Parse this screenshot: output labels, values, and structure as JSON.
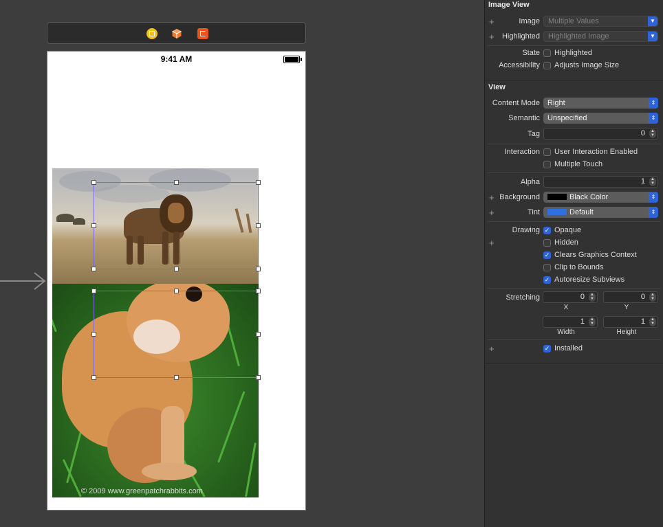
{
  "canvas": {
    "status_time": "9:41 AM",
    "watermark": "© 2009 www.greenpatchrabbits.com"
  },
  "inspector": {
    "image_view": {
      "title": "Image View",
      "image_label": "Image",
      "image_placeholder": "Multiple Values",
      "highlighted_label": "Highlighted",
      "highlighted_placeholder": "Highlighted Image",
      "state_label": "State",
      "state_checkbox": "Highlighted",
      "accessibility_label": "Accessibility",
      "accessibility_checkbox": "Adjusts Image Size"
    },
    "view": {
      "title": "View",
      "content_mode_label": "Content Mode",
      "content_mode_value": "Right",
      "semantic_label": "Semantic",
      "semantic_value": "Unspecified",
      "tag_label": "Tag",
      "tag_value": "0",
      "interaction_label": "Interaction",
      "user_interaction": "User Interaction Enabled",
      "multiple_touch": "Multiple Touch",
      "alpha_label": "Alpha",
      "alpha_value": "1",
      "background_label": "Background",
      "background_value": "Black Color",
      "background_color": "#000000",
      "tint_label": "Tint",
      "tint_value": "Default",
      "tint_color": "#2f6fe0",
      "drawing_label": "Drawing",
      "opaque": "Opaque",
      "hidden": "Hidden",
      "clears_graphics": "Clears Graphics Context",
      "clip_to_bounds": "Clip to Bounds",
      "autoresize": "Autoresize Subviews",
      "stretching_label": "Stretching",
      "stretch_x": "0",
      "stretch_y": "0",
      "stretch_width": "1",
      "stretch_height": "1",
      "x_caption": "X",
      "y_caption": "Y",
      "width_caption": "Width",
      "height_caption": "Height",
      "installed": "Installed"
    }
  }
}
